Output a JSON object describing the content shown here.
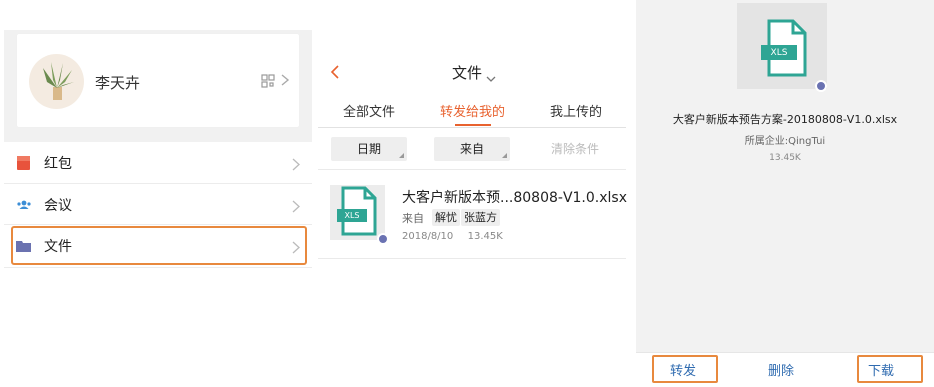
{
  "panel1": {
    "profile": {
      "name": "李天卉"
    },
    "menu": [
      {
        "label": "红包",
        "icon": "red-packet-icon",
        "color": "#e8533c"
      },
      {
        "label": "会议",
        "icon": "people-icon",
        "color": "#3c8ed6"
      },
      {
        "label": "文件",
        "icon": "folder-icon",
        "color": "#6b72b0"
      }
    ]
  },
  "panel2": {
    "title": "文件",
    "tabs": [
      {
        "label": "全部文件",
        "active": false
      },
      {
        "label": "转发给我的",
        "active": true
      },
      {
        "label": "我上传的",
        "active": false
      }
    ],
    "filters": {
      "date": "日期",
      "from": "来自",
      "clear": "清除条件"
    },
    "file": {
      "type_label": "XLS",
      "name": "大客户新版本预...80808-V1.0.xlsx",
      "from_label": "来自",
      "from_users": [
        "解忧",
        "张蓝方"
      ],
      "date": "2018/8/10",
      "size": "13.45K"
    }
  },
  "panel3": {
    "file": {
      "type_label": "XLS",
      "name": "大客户新版本预告方案-20180808-V1.0.xlsx",
      "company": "所属企业:QingTui",
      "size": "13.45K"
    },
    "actions": {
      "forward": "转发",
      "delete": "删除",
      "download": "下载"
    }
  },
  "colors": {
    "accent": "#e8622f",
    "highlight": "#e8893e",
    "file_teal": "#2ea594",
    "link_blue": "#2f6bb0"
  }
}
